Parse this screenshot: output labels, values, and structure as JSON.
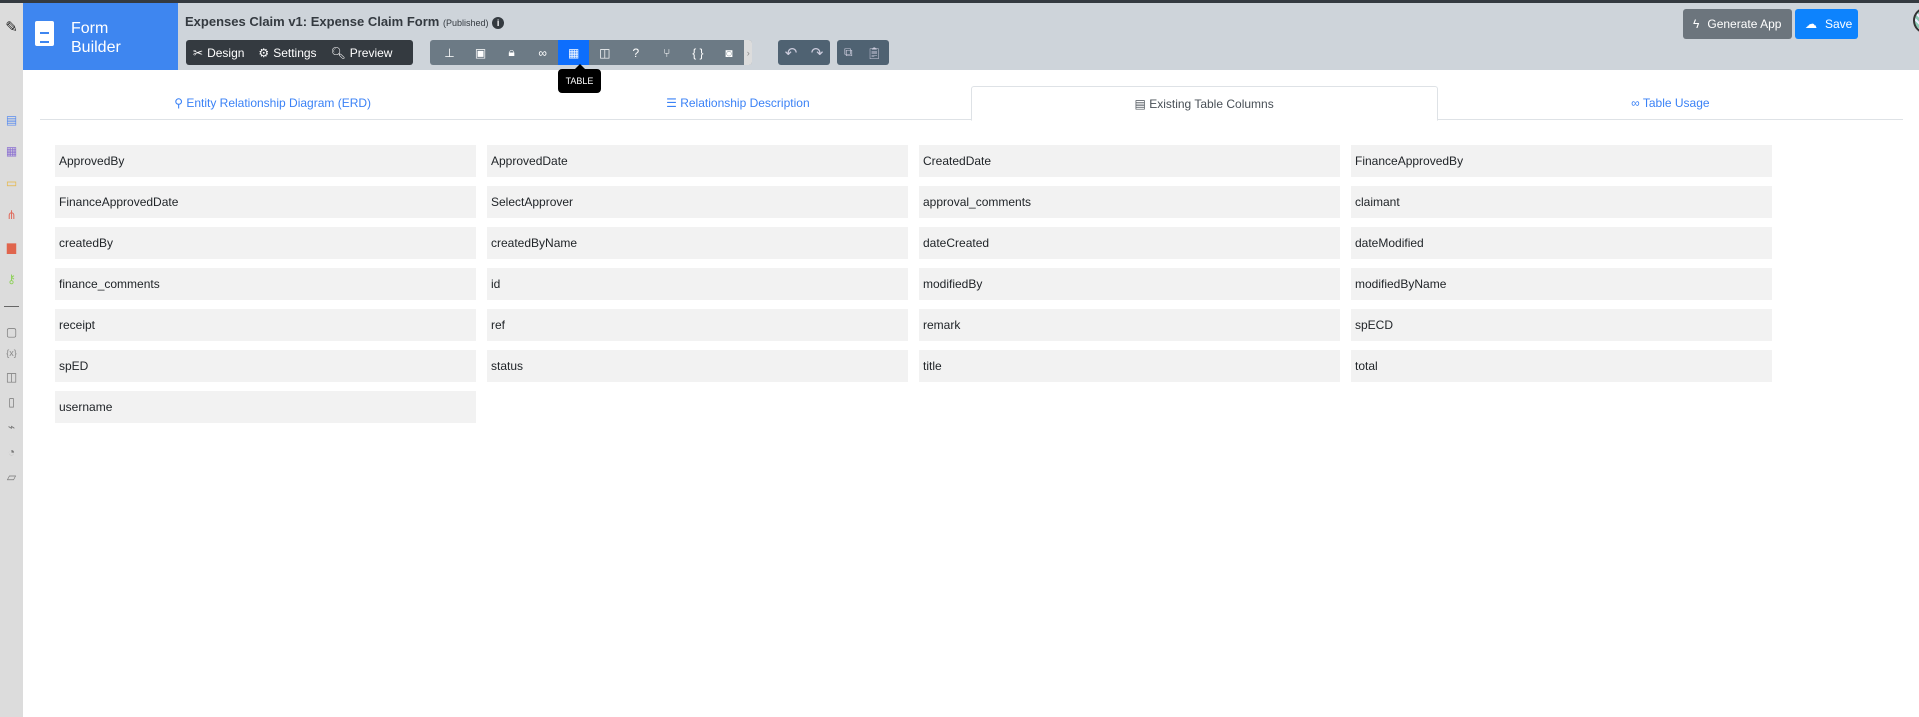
{
  "sidebar": {
    "icons": [
      "edit-icon",
      "form-icon",
      "table-icon",
      "monitor-icon",
      "workflow-icon",
      "pdf-icon",
      "key-icon",
      "note-icon",
      "variable-icon",
      "translate-icon",
      "report-icon",
      "plugin-icon",
      "dashboard-icon",
      "script-icon"
    ]
  },
  "header": {
    "brand": "Form Builder",
    "title": "Expenses Claim v1: Expense Claim Form",
    "status": "(Published)",
    "mode_buttons": [
      "Design",
      "Settings",
      "Preview"
    ],
    "tooltip": "TABLE",
    "generate_label": "Generate App",
    "save_label": "Save"
  },
  "tabs": [
    "Entity Relationship Diagram (ERD)",
    "Relationship Description",
    "Existing Table Columns",
    "Table Usage"
  ],
  "columns": [
    "ApprovedBy",
    "ApprovedDate",
    "CreatedDate",
    "FinanceApprovedBy",
    "FinanceApprovedDate",
    "SelectApprover",
    "approval_comments",
    "claimant",
    "createdBy",
    "createdByName",
    "dateCreated",
    "dateModified",
    "finance_comments",
    "id",
    "modifiedBy",
    "modifiedByName",
    "receipt",
    "ref",
    "remark",
    "spECD",
    "spED",
    "status",
    "title",
    "total",
    "username"
  ]
}
